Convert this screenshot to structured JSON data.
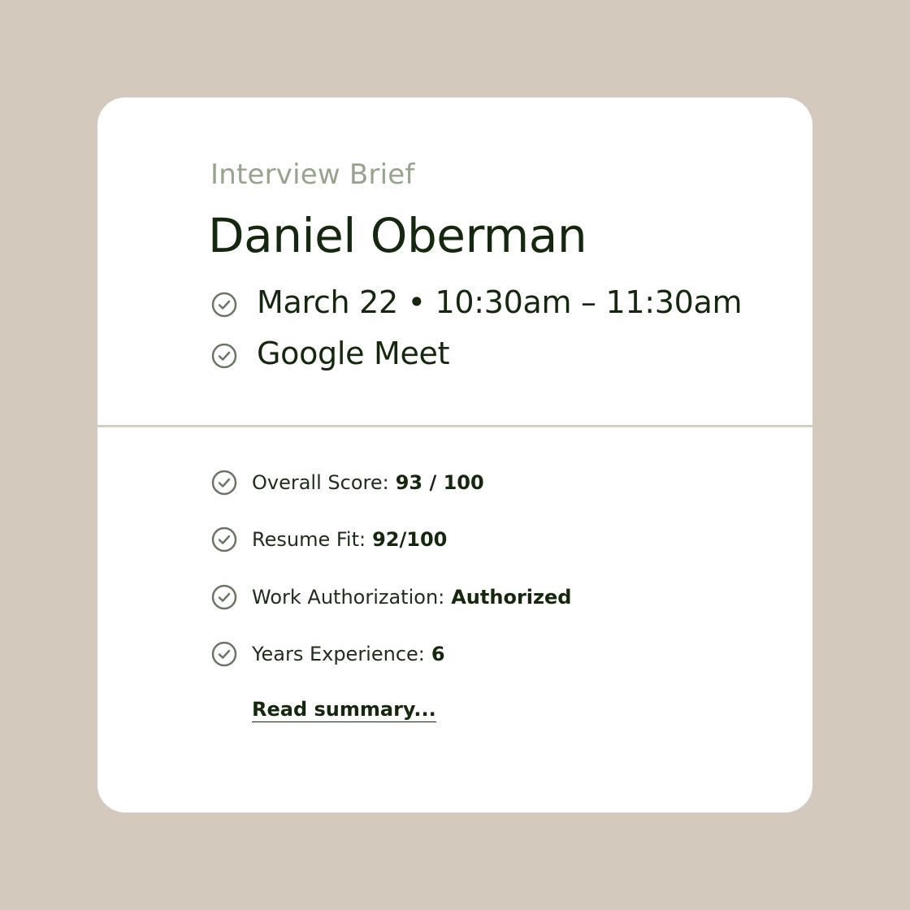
{
  "colors": {
    "background": "#d3cabd",
    "card": "#ffffff",
    "eyebrow": "#98a38f",
    "text_dark": "#15280f",
    "icon": "#6b7565",
    "divider": "#d6cfc3"
  },
  "header": {
    "eyebrow": "Interview Brief",
    "name": "Daniel Oberman"
  },
  "meta": [
    {
      "icon": "check-circle-icon",
      "text": "March 22 • 10:30am – 11:30am"
    },
    {
      "icon": "check-circle-icon",
      "text": "Google Meet"
    }
  ],
  "stats": [
    {
      "icon": "check-circle-icon",
      "label": "Overall Score:",
      "value": "93 / 100"
    },
    {
      "icon": "check-circle-icon",
      "label": "Resume Fit:",
      "value": "92/100"
    },
    {
      "icon": "check-circle-icon",
      "label": "Work Authorization:",
      "value": "Authorized"
    },
    {
      "icon": "check-circle-icon",
      "label": "Years Experience:",
      "value": "6"
    }
  ],
  "summary_link": "Read summary..."
}
